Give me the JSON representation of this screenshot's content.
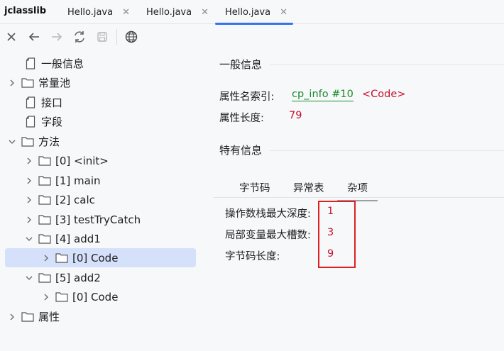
{
  "app": {
    "title": "jclasslib"
  },
  "tabs": [
    {
      "label": "Hello.java",
      "close": "✕"
    },
    {
      "label": "Hello.java",
      "close": "✕"
    },
    {
      "label": "Hello.java",
      "close": "✕",
      "active": true
    }
  ],
  "toolbar": {
    "buttons": [
      "close-icon",
      "back-arrow-icon",
      "forward-arrow-icon",
      "refresh-icon",
      "save-icon",
      "globe-icon"
    ]
  },
  "tree": {
    "general": "一般信息",
    "constant_pool": "常量池",
    "interfaces": "接口",
    "fields": "字段",
    "methods": "方法",
    "method_items": [
      "[0] <init>",
      "[1] main",
      "[2] calc",
      "[3] testTryCatch",
      "[4] add1",
      "[5] add2"
    ],
    "add1_code": "[0] Code",
    "add2_code": "[0] Code",
    "attributes": "属性"
  },
  "general_info": {
    "title": "一般信息",
    "name_index_label": "属性名索引:",
    "name_index_link": "cp_info #10",
    "name_index_value": "<Code>",
    "length_label": "属性长度:",
    "length_value": "79"
  },
  "specific_info": {
    "title": "特有信息",
    "subtabs": [
      "字节码",
      "异常表",
      "杂项"
    ],
    "active_subtab": "杂项",
    "rows": [
      {
        "label": "操作数栈最大深度:",
        "value": "1"
      },
      {
        "label": "局部变量最大槽数:",
        "value": "3"
      },
      {
        "label": "字节码长度:",
        "value": "9"
      }
    ]
  },
  "colors": {
    "accent": "#3574f0",
    "selection": "#d5e1fb",
    "link_green": "#1a8a2a",
    "value_red": "#c8102e",
    "highlight_box": "#e02020"
  }
}
